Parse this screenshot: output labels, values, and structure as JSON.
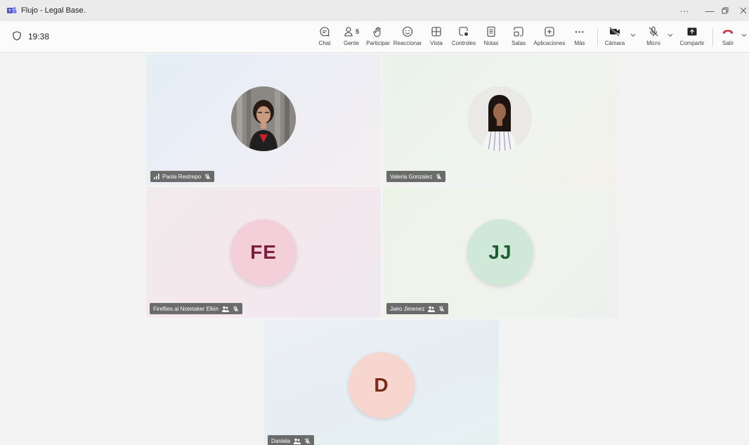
{
  "window": {
    "title": "Flujo - Legal Base."
  },
  "meeting": {
    "elapsed": "19:38"
  },
  "toolbar": {
    "people_count": "5",
    "buttons": {
      "chat": "Chat",
      "people": "Gente",
      "raise_hand": "Participar",
      "react": "Reaccionar",
      "view": "Vista",
      "controls": "Controles",
      "notes": "Notas",
      "rooms": "Salas",
      "apps": "Aplicaciones",
      "more": "Más",
      "camera": "Cámara",
      "mic": "Micro",
      "share": "Compartir",
      "leave": "Salir"
    }
  },
  "participants": [
    {
      "name": "Paola Restrepo",
      "initials": "",
      "has_photo": true
    },
    {
      "name": "Valeria Gonzalez",
      "initials": "",
      "has_photo": true
    },
    {
      "name": "Fireflies.ai Notetaker Elkin",
      "initials": "FE",
      "has_photo": false,
      "avatar_bg": "#f2cfd9",
      "avatar_fg": "#7a2140"
    },
    {
      "name": "Jairo Jimenez",
      "initials": "JJ",
      "has_photo": false,
      "avatar_bg": "#cfe8d8",
      "avatar_fg": "#1f5a33"
    },
    {
      "name": "Daniela",
      "initials": "D",
      "has_photo": false,
      "avatar_bg": "#f6d6cf",
      "avatar_fg": "#7a2a18"
    }
  ],
  "colors": {
    "leave": "#c4314b",
    "nametag_bg": "#6b6b6b",
    "background": "#f3f3f3"
  },
  "icons": [
    "teams-logo-icon",
    "shield-icon",
    "chat-icon",
    "people-icon",
    "hand-icon",
    "smiley-icon",
    "view-grid-icon",
    "controls-icon",
    "notes-icon",
    "rooms-icon",
    "add-app-icon",
    "ellipsis-icon",
    "camera-off-icon",
    "mic-off-icon",
    "share-icon",
    "phone-hangup-icon"
  ]
}
